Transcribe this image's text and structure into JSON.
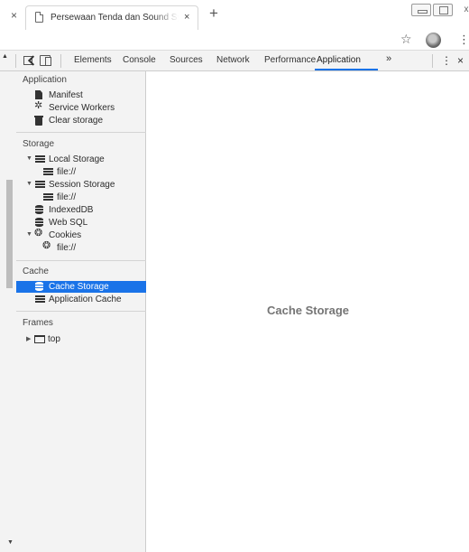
{
  "browser": {
    "close_left": "×",
    "tab_title": "Persewaan Tenda dan Sound System",
    "tab_close": "×",
    "new_tab": "+",
    "window_close": "x",
    "star": "☆",
    "menu": "⋮"
  },
  "devtools": {
    "tabs": [
      "Elements",
      "Console",
      "Sources",
      "Network",
      "Performance",
      "Application"
    ],
    "active_tab": "Application",
    "more": "»",
    "menu": "⋮",
    "close": "×",
    "accent": "#1a73e8"
  },
  "sidebar": {
    "application": {
      "title": "Application",
      "items": [
        "Manifest",
        "Service Workers",
        "Clear storage"
      ]
    },
    "storage": {
      "title": "Storage",
      "local_storage": "Local Storage",
      "local_storage_child": "file://",
      "session_storage": "Session Storage",
      "session_storage_child": "file://",
      "indexeddb": "IndexedDB",
      "websql": "Web SQL",
      "cookies": "Cookies",
      "cookies_child": "file://"
    },
    "cache": {
      "title": "Cache",
      "cache_storage": "Cache Storage",
      "application_cache": "Application Cache",
      "selected": "Cache Storage"
    },
    "frames": {
      "title": "Frames",
      "top": "top"
    }
  },
  "main": {
    "title": "Cache Storage"
  }
}
